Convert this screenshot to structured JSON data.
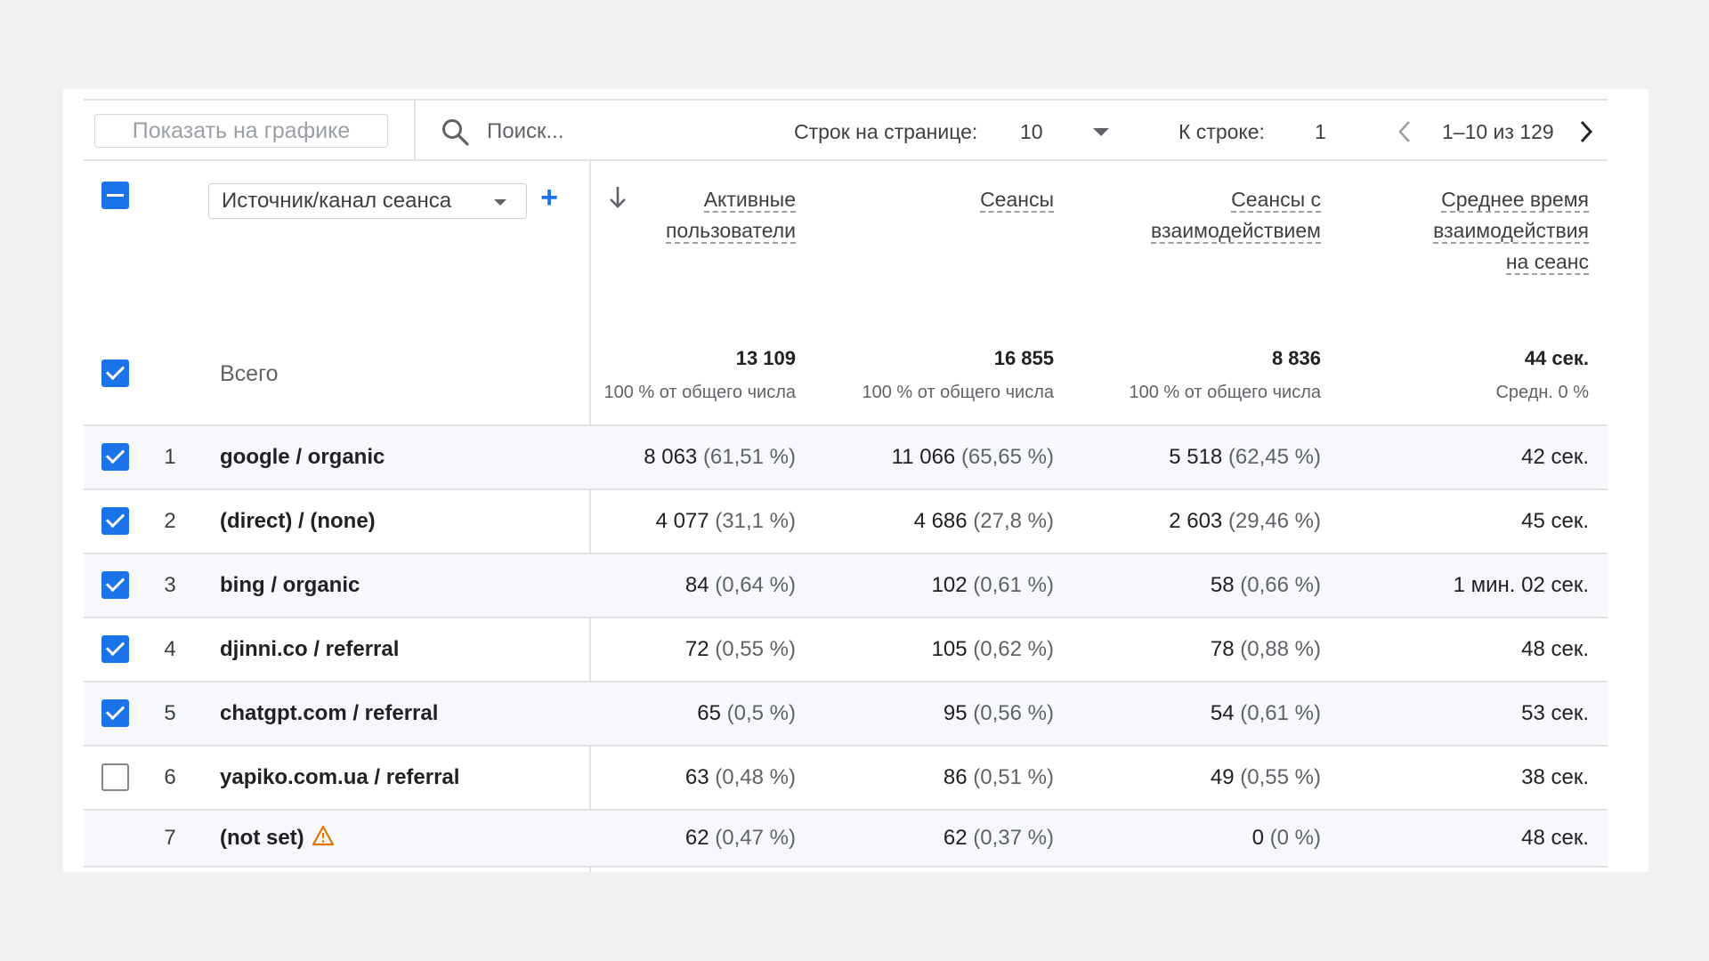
{
  "toolbar": {
    "show_on_chart": "Показать на графике",
    "search_placeholder": "Поиск...",
    "rows_per_page_label": "Строк на странице:",
    "rows_per_page_value": "10",
    "go_to_row_label": "К строке:",
    "go_to_row_value": "1",
    "page_range": "1–10 из 129"
  },
  "dimension": {
    "label": "Источник/канал сеанса",
    "add_symbol": "+"
  },
  "columns": [
    {
      "line1": "Активные",
      "line2": "пользователи",
      "line3": ""
    },
    {
      "line1": "Сеансы",
      "line2": "",
      "line3": ""
    },
    {
      "line1": "Сеансы с",
      "line2": "взаимодействием",
      "line3": ""
    },
    {
      "line1": "Среднее время",
      "line2": "взаимодействия",
      "line3": "на сеанс"
    }
  ],
  "totals": {
    "label": "Всего",
    "values": [
      "13 109",
      "16 855",
      "8 836",
      "44 сек."
    ],
    "subs": [
      "100 % от общего числа",
      "100 % от общего числа",
      "100 % от общего числа",
      "Средн. 0 %"
    ]
  },
  "rows": [
    {
      "num": "1",
      "dim": "google / organic",
      "checked": true,
      "c1": "8 063",
      "p1": "(61,51 %)",
      "c2": "11 066",
      "p2": "(65,65 %)",
      "c3": "5 518",
      "p3": "(62,45 %)",
      "c4": "42 сек."
    },
    {
      "num": "2",
      "dim": "(direct) / (none)",
      "checked": true,
      "c1": "4 077",
      "p1": "(31,1 %)",
      "c2": "4 686",
      "p2": "(27,8 %)",
      "c3": "2 603",
      "p3": "(29,46 %)",
      "c4": "45 сек."
    },
    {
      "num": "3",
      "dim": "bing / organic",
      "checked": true,
      "c1": "84",
      "p1": "(0,64 %)",
      "c2": "102",
      "p2": "(0,61 %)",
      "c3": "58",
      "p3": "(0,66 %)",
      "c4": "1 мин. 02 сек."
    },
    {
      "num": "4",
      "dim": "djinni.co / referral",
      "checked": true,
      "c1": "72",
      "p1": "(0,55 %)",
      "c2": "105",
      "p2": "(0,62 %)",
      "c3": "78",
      "p3": "(0,88 %)",
      "c4": "48 сек."
    },
    {
      "num": "5",
      "dim": "chatgpt.com / referral",
      "checked": true,
      "c1": "65",
      "p1": "(0,5 %)",
      "c2": "95",
      "p2": "(0,56 %)",
      "c3": "54",
      "p3": "(0,61 %)",
      "c4": "53 сек."
    },
    {
      "num": "6",
      "dim": "yapiko.com.ua / referral",
      "checked": false,
      "c1": "63",
      "p1": "(0,48 %)",
      "c2": "86",
      "p2": "(0,51 %)",
      "c3": "49",
      "p3": "(0,55 %)",
      "c4": "38 сек."
    },
    {
      "num": "7",
      "dim": "(not set)",
      "checked": null,
      "warning": "warning-triangle-icon",
      "c1": "62",
      "p1": "(0,47 %)",
      "c2": "62",
      "p2": "(0,37 %)",
      "c3": "0",
      "p3": "(0 %)",
      "c4": "48 сек."
    }
  ],
  "colors": {
    "accent": "#1a73e8",
    "warning": "#e37400",
    "divider": "#e3e3e3"
  }
}
